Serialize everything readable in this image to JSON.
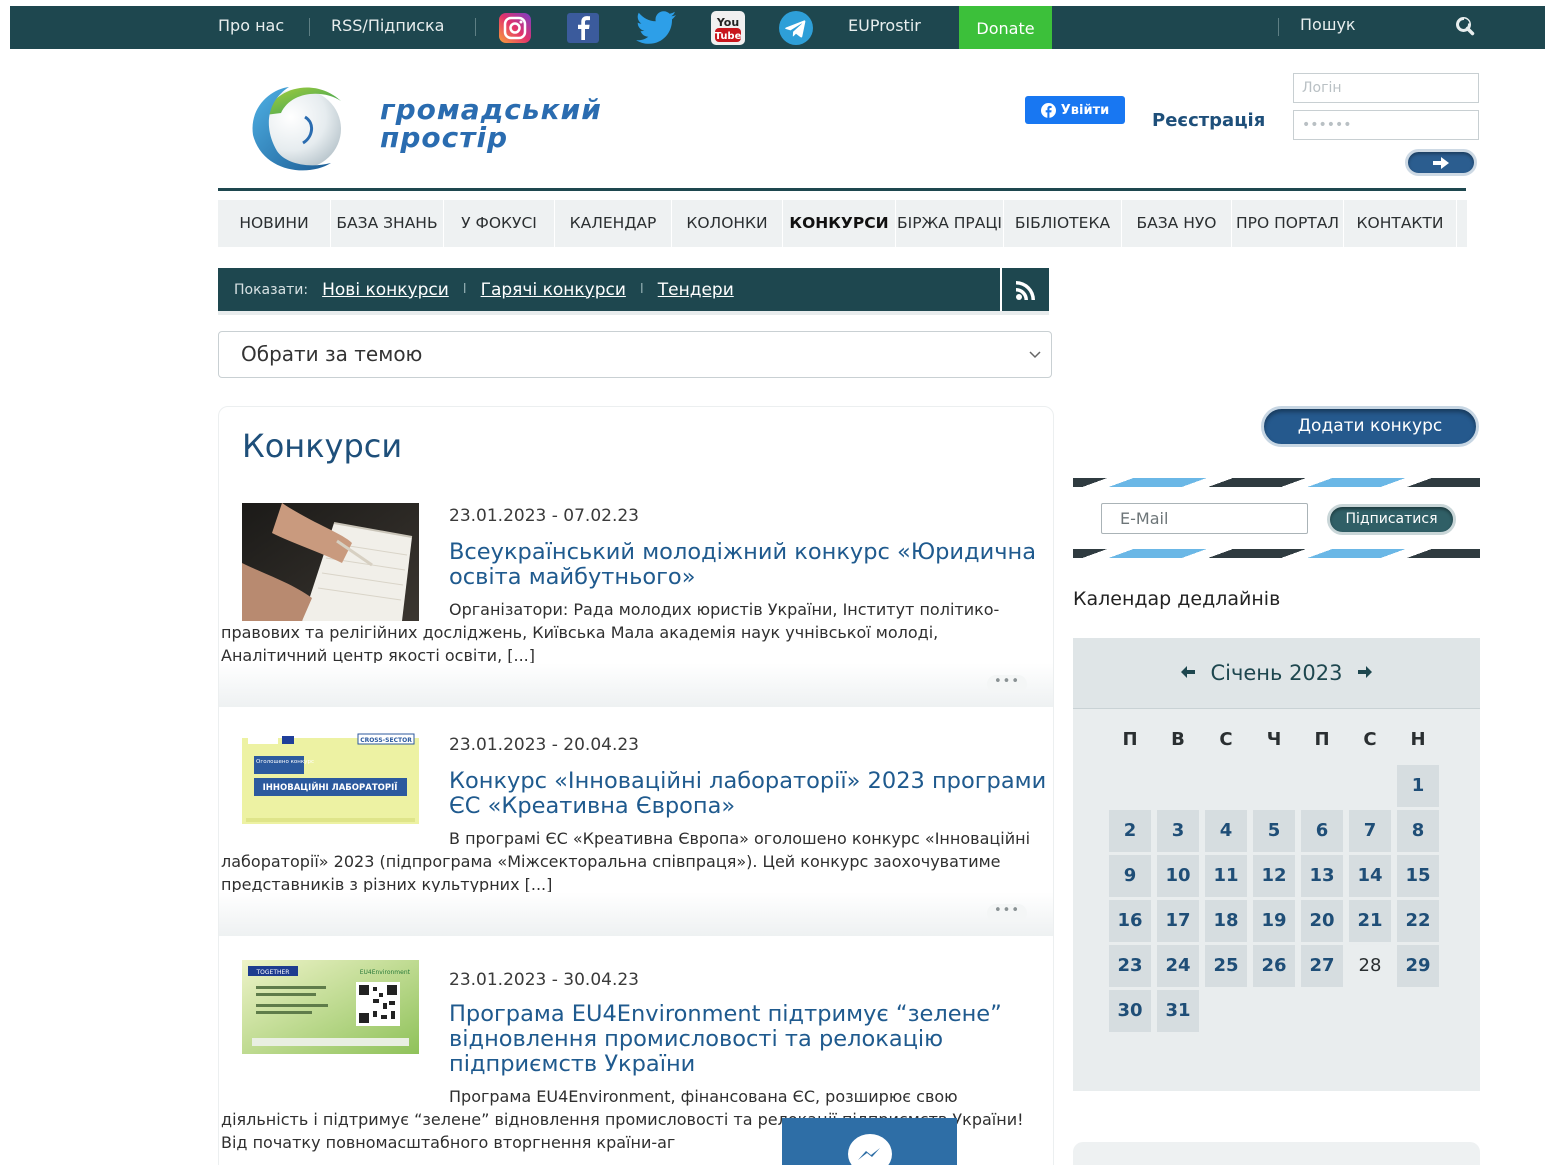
{
  "topbar": {
    "about": "Про нас",
    "rss": "RSS/Підписка",
    "social_icons": [
      "instagram-icon",
      "facebook-icon",
      "twitter-icon",
      "youtube-icon",
      "telegram-icon"
    ],
    "youtube_top": "You",
    "youtube_bottom": "Tube",
    "euprostir": "EUProstir",
    "donate": "Donate",
    "search": "Пошук"
  },
  "header": {
    "logo_line1": "громадський",
    "logo_line2": "простір",
    "fb_login": "Увійти",
    "register": "Реєстрація",
    "login_placeholder": "Логін",
    "password_placeholder": "••••••"
  },
  "nav": [
    {
      "label": "НОВИНИ",
      "active": false
    },
    {
      "label": "БАЗА ЗНАНЬ",
      "active": false
    },
    {
      "label": "У ФОКУСІ",
      "active": false
    },
    {
      "label": "КАЛЕНДАР",
      "active": false
    },
    {
      "label": "КОЛОНКИ",
      "active": false
    },
    {
      "label": "КОНКУРСИ",
      "active": true
    },
    {
      "label": "БІРЖА ПРАЦІ",
      "active": false
    },
    {
      "label": "БІБЛІОТЕКА",
      "active": false
    },
    {
      "label": "БАЗА НУО",
      "active": false
    },
    {
      "label": "ПРО ПОРТАЛ",
      "active": false
    },
    {
      "label": "КОНТАКТИ",
      "active": false
    }
  ],
  "filter": {
    "show_label": "Показати:",
    "links": [
      "Нові конкурси",
      "Гарячі конкурси",
      "Тендери"
    ],
    "separator": "I",
    "select_value": "Обрати за темою"
  },
  "main": {
    "title": "Конкурси",
    "more": "•••",
    "entries": [
      {
        "date": "23.01.2023 - 07.02.23",
        "title": "Всеукраїнський молодіжний конкурс «Юридична освіта майбутнього»",
        "desc": "Організатори: Рада молодих юристів України, Інститут політико-правових та релігійних досліджень, Київська Мала академія наук учнівської молоді, Аналітичний центр якості освіти, [...]"
      },
      {
        "date": "23.01.2023 - 20.04.23",
        "title": "Конкурс «Інноваційні лабораторії» 2023 програми ЄС «Креативна Європа»",
        "desc": "В програмі ЄС «Креативна Європа» оголошено конкурс «Інноваційні лабораторії» 2023 (підпрограма «Міжсекторальна співпраця»). Цей конкурс заохочуватиме представників з різних культурних [...]",
        "thumb_top": "CROSS-SECTOR",
        "thumb_tag": "Оголошено конкурс",
        "thumb_text": "ІННОВАЦІЙНІ ЛАБОРАТОРІЇ"
      },
      {
        "date": "23.01.2023 - 30.04.23",
        "title": "Програма EU4Environment підтримує “зелене” відновлення промисловості та релокацію підприємств України",
        "desc": "Програма EU4Environment, фінансована ЄС, розширює свою діяльність і підтримує “зелене” відновлення промисловості та релокації підприємств України!Від початку повномасштабного вторгнення країни-аг",
        "thumb_left": "TOGETHER",
        "thumb_right": "EU4Environment"
      }
    ]
  },
  "sidebar": {
    "add_contest": "Додати конкурс",
    "email_placeholder": "E-Mail",
    "subscribe": "Підписатися",
    "calendar_caption": "Календар дедлайнів",
    "month": "Січень 2023",
    "weekdays": [
      "П",
      "В",
      "С",
      "Ч",
      "П",
      "С",
      "Н"
    ],
    "days": [
      "1",
      "2",
      "3",
      "4",
      "5",
      "6",
      "7",
      "8",
      "9",
      "10",
      "11",
      "12",
      "13",
      "14",
      "15",
      "16",
      "17",
      "18",
      "19",
      "20",
      "21",
      "22",
      "23",
      "24",
      "25",
      "26",
      "27",
      "28",
      "29",
      "30",
      "31"
    ],
    "plain_days": [
      "28"
    ]
  },
  "colors": {
    "topbar": "#1e474f",
    "donate": "#3cc03a",
    "link_blue": "#1f5a8e",
    "fb_blue": "#1877f2"
  }
}
